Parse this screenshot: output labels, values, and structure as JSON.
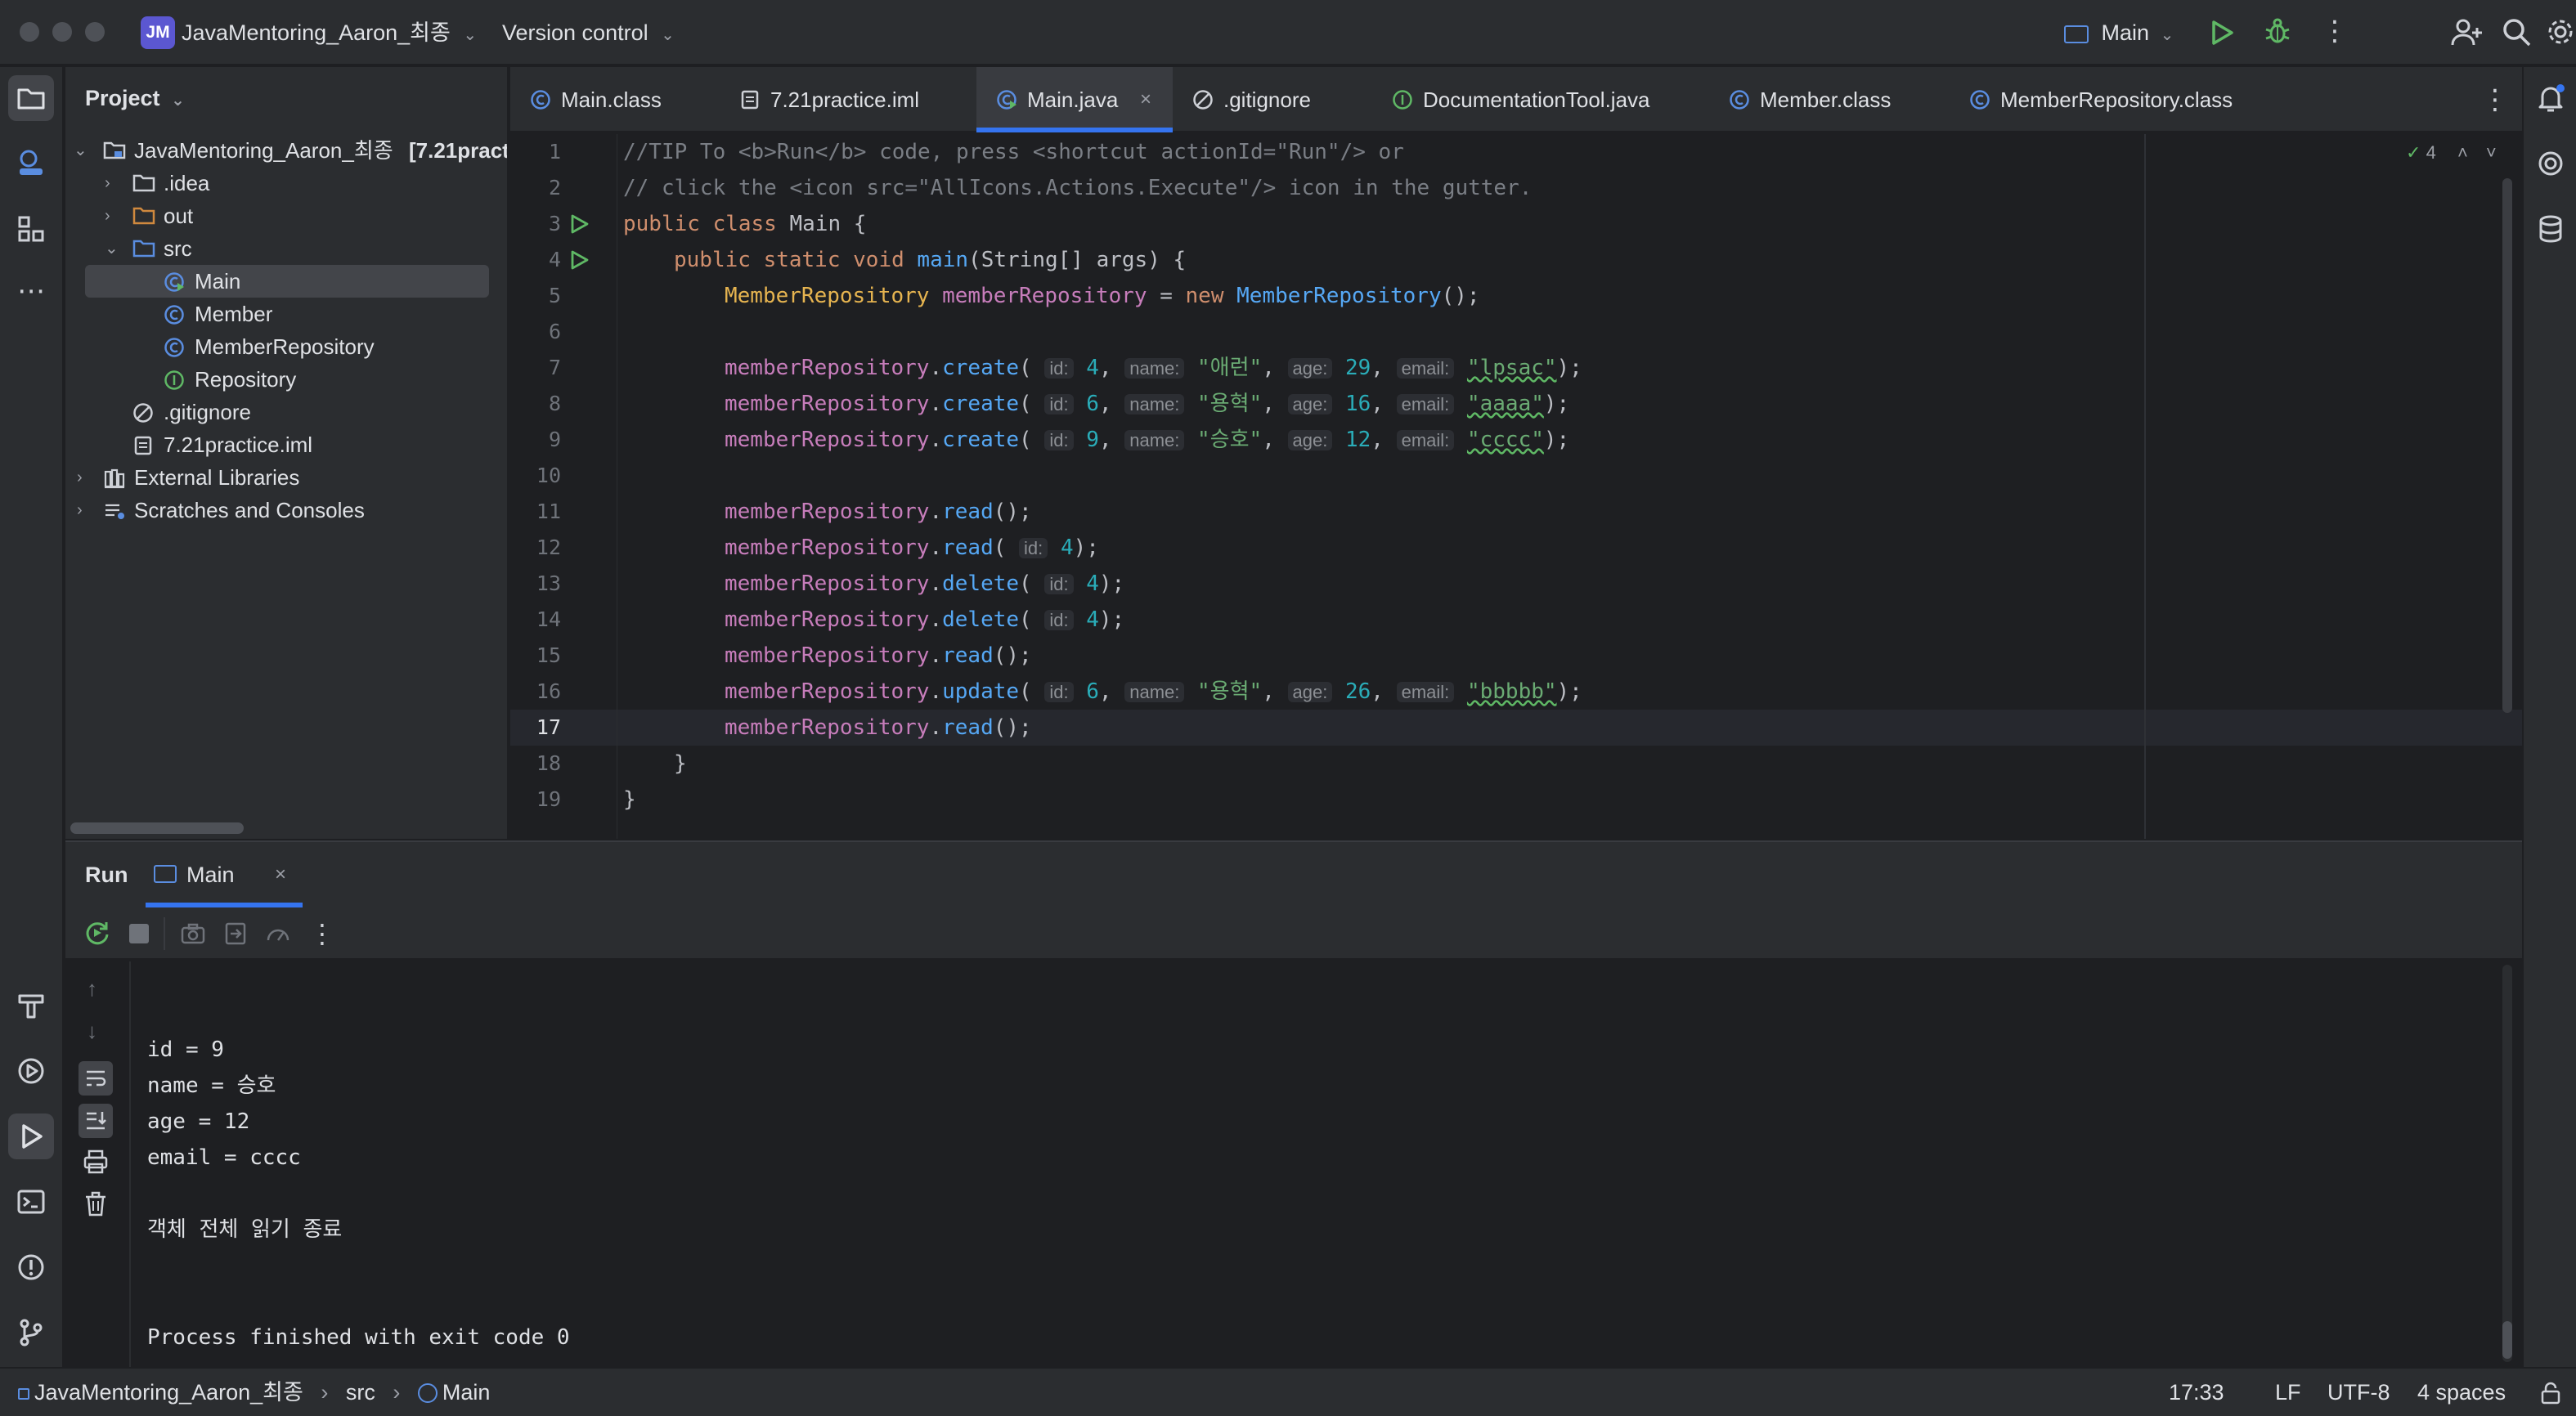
{
  "titlebar": {
    "project_badge": "JM",
    "project_name": "JavaMentoring_Aaron_최종",
    "vcs_label": "Version control",
    "run_config": "Main"
  },
  "project_panel": {
    "title": "Project",
    "items": [
      {
        "label": "JavaMentoring_Aaron_최종",
        "suffix": "[7.21pract",
        "depth": 0,
        "type": "module",
        "expanded": true
      },
      {
        "label": ".idea",
        "depth": 1,
        "type": "folder",
        "expanded": false
      },
      {
        "label": "out",
        "depth": 1,
        "type": "folder-orange",
        "expanded": false
      },
      {
        "label": "src",
        "depth": 1,
        "type": "folder-blue",
        "expanded": true
      },
      {
        "label": "Main",
        "depth": 2,
        "type": "class-run",
        "selected": true
      },
      {
        "label": "Member",
        "depth": 2,
        "type": "class"
      },
      {
        "label": "MemberRepository",
        "depth": 2,
        "type": "class"
      },
      {
        "label": "Repository",
        "depth": 2,
        "type": "interface"
      },
      {
        "label": ".gitignore",
        "depth": 1,
        "type": "ignore"
      },
      {
        "label": "7.21practice.iml",
        "depth": 1,
        "type": "file"
      },
      {
        "label": "External Libraries",
        "depth": 0,
        "type": "libs",
        "expanded": false
      },
      {
        "label": "Scratches and Consoles",
        "depth": 0,
        "type": "scratch",
        "expanded": false
      }
    ]
  },
  "editor_tabs": [
    {
      "label": "Main.class",
      "icon": "class-icon"
    },
    {
      "label": "7.21practice.iml",
      "icon": "file-icon"
    },
    {
      "label": "Main.java",
      "icon": "class-run-icon",
      "active": true
    },
    {
      "label": ".gitignore",
      "icon": "ignore-icon"
    },
    {
      "label": "DocumentationTool.java",
      "icon": "interface-icon"
    },
    {
      "label": "Member.class",
      "icon": "class-icon"
    },
    {
      "label": "MemberRepository.class",
      "icon": "class-icon"
    }
  ],
  "editor": {
    "inspection_count": "4",
    "current_line": 17,
    "line_numbers": [
      "1",
      "2",
      "3",
      "4",
      "5",
      "6",
      "7",
      "8",
      "9",
      "10",
      "11",
      "12",
      "13",
      "14",
      "15",
      "16",
      "17",
      "18",
      "19"
    ],
    "code": {
      "l1": "//TIP To <b>Run</b> code, press <shortcut actionId=\"Run\"/> or",
      "l2": "// click the <icon src=\"AllIcons.Actions.Execute\"/> icon in the gutter.",
      "l3_kw": "public class",
      "l3_name": "Main",
      "l3_brace": " {",
      "l4_kw": "public static void",
      "l4_fn": "main",
      "l4_args": "(String[] args) {",
      "l5_type": "MemberRepository",
      "l5_var": "memberRepository",
      "l5_eq": " = ",
      "l5_new": "new",
      "l5_ctor": "MemberRepository",
      "l5_end": "();",
      "repo": "memberRepository",
      "create": "create",
      "read": "read",
      "delete": "delete",
      "update": "update",
      "hint_id": "id:",
      "hint_name": "name:",
      "hint_age": "age:",
      "hint_email": "email:",
      "c1": {
        "id": "4",
        "name": "\"애런\"",
        "age": "29",
        "email": "\"lpsac\""
      },
      "c2": {
        "id": "6",
        "name": "\"용혁\"",
        "age": "16",
        "email": "\"aaaa\""
      },
      "c3": {
        "id": "9",
        "name": "\"승호\"",
        "age": "12",
        "email": "\"cccc\""
      },
      "read_arg": "4",
      "delete_arg1": "4",
      "delete_arg2": "4",
      "u1": {
        "id": "6",
        "name": "\"용혁\"",
        "age": "26",
        "email": "\"bbbbb\""
      },
      "l18": "}",
      "l19": "}"
    }
  },
  "run_panel": {
    "title": "Run",
    "tab_label": "Main",
    "output": [
      "id = 9",
      "name = 승호",
      "age = 12",
      "email = cccc",
      "",
      "객체 전체 읽기 종료",
      "",
      "",
      "Process finished with exit code 0"
    ]
  },
  "statusbar": {
    "breadcrumb_project": "JavaMentoring_Aaron_최종",
    "breadcrumb_src": "src",
    "breadcrumb_main": "Main",
    "caret": "17:33",
    "line_sep": "LF",
    "encoding": "UTF-8",
    "indent": "4 spaces"
  }
}
